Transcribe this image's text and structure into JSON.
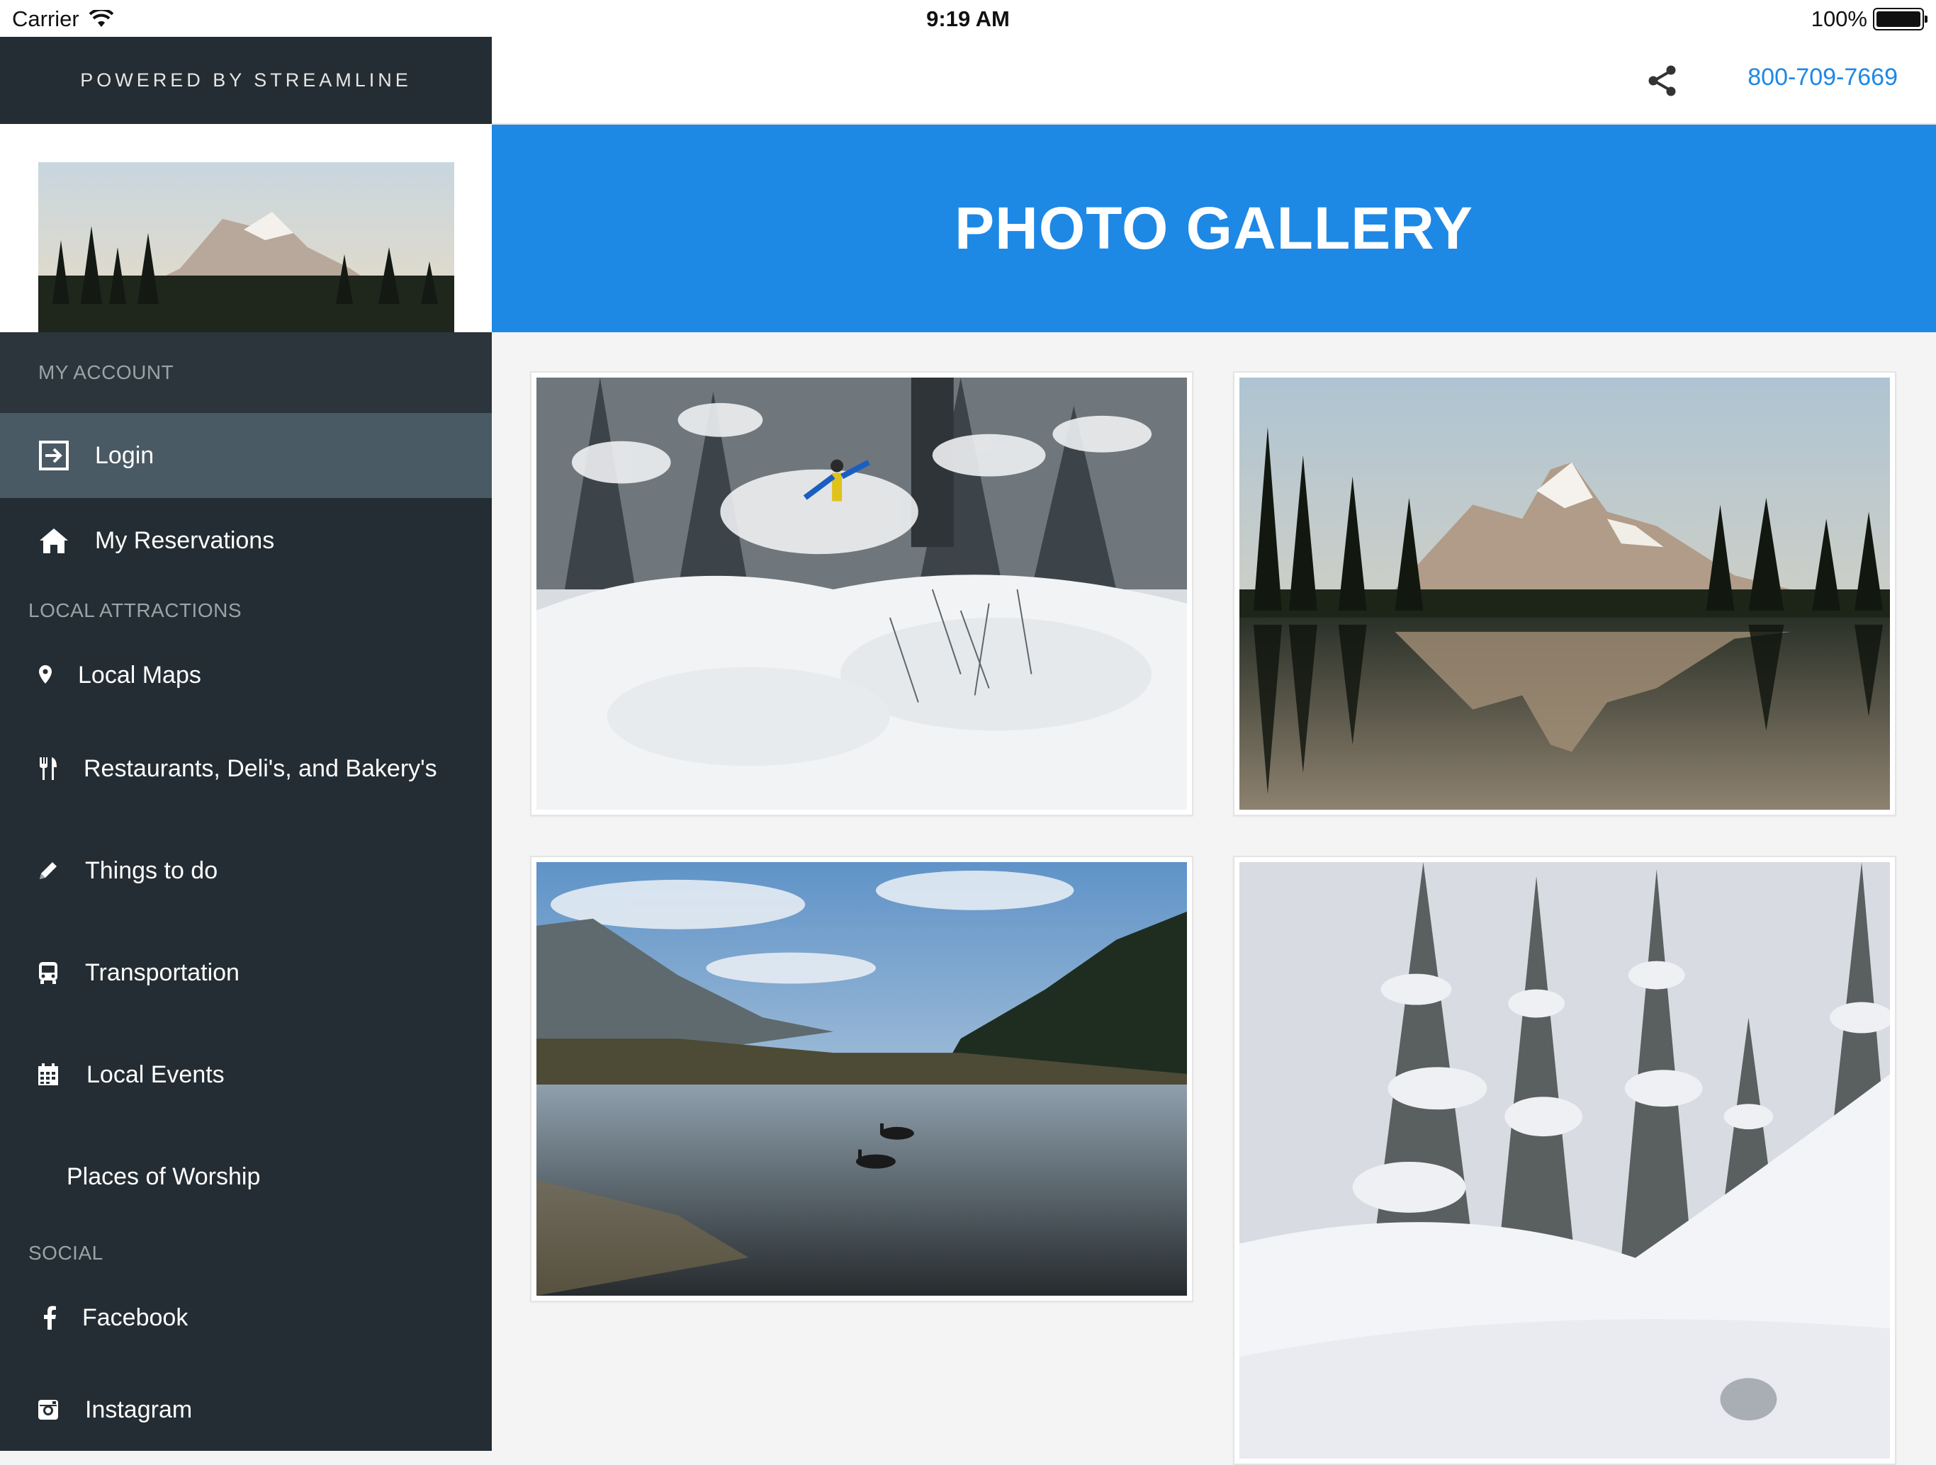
{
  "status_bar": {
    "carrier": "Carrier",
    "time": "9:19 AM",
    "battery": "100%"
  },
  "sidebar": {
    "powered_by": "POWERED BY STREAMLINE",
    "my_account_header": "MY ACCOUNT",
    "account_items": [
      {
        "label": "Login",
        "icon": "login-icon",
        "active": true
      },
      {
        "label": "My Reservations",
        "icon": "home-icon"
      }
    ],
    "local_attractions_header": "LOCAL ATTRACTIONS",
    "attraction_items": [
      {
        "label": "Local Maps",
        "icon": "map-pin-icon"
      },
      {
        "label": "Restaurants, Deli's, and Bakery's",
        "icon": "fork-knife-icon"
      },
      {
        "label": "Things to do",
        "icon": "pencil-icon"
      },
      {
        "label": "Transportation",
        "icon": "bus-icon"
      },
      {
        "label": "Local Events",
        "icon": "calendar-icon"
      },
      {
        "label": "Places of Worship",
        "icon": ""
      }
    ],
    "social_header": "SOCIAL",
    "social_items": [
      {
        "label": "Facebook",
        "icon": "facebook-icon"
      },
      {
        "label": "Instagram",
        "icon": "instagram-icon"
      }
    ]
  },
  "topbar": {
    "phone": "800-709-7669",
    "share_icon": "share-icon"
  },
  "banner": {
    "title": "PHOTO GALLERY"
  },
  "gallery": {
    "photos": [
      {
        "subject": "skier in snowy forest"
      },
      {
        "subject": "mountain lake reflection"
      },
      {
        "subject": "river with ducks"
      },
      {
        "subject": "snow covered trees"
      }
    ]
  },
  "colors": {
    "accent": "#1e88e5",
    "sidebar_bg": "#242d33",
    "active_item": "#4a5a64"
  }
}
